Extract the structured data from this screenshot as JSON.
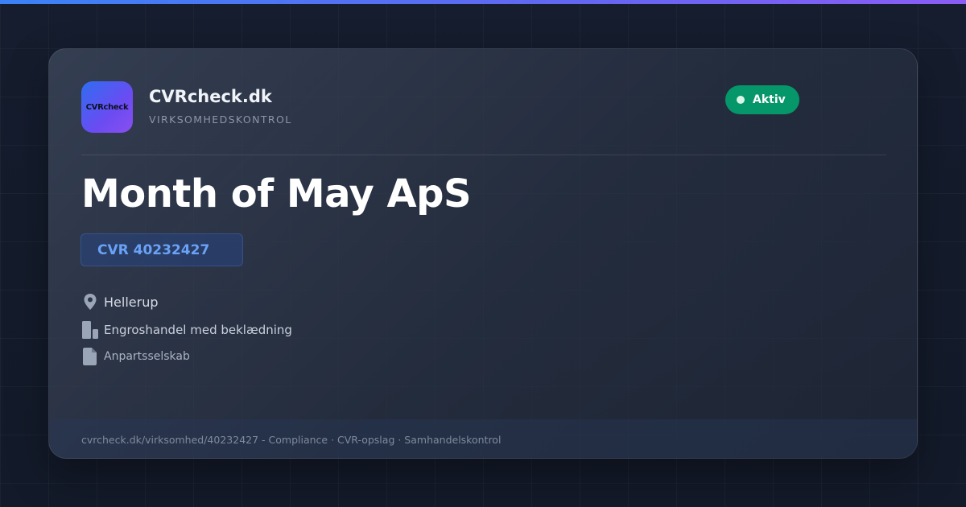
{
  "brand": {
    "name": "CVRcheck.dk",
    "tagline": "VIRKSOMHEDSKONTROL",
    "logo_text": "CVRcheck"
  },
  "status": {
    "label": "Aktiv",
    "color": "#059669"
  },
  "company": {
    "name": "Month of May ApS",
    "cvr": "CVR 40232427",
    "city": "Hellerup",
    "industry": "Engroshandel med beklædning",
    "type": "Anpartsselskab"
  },
  "icons": {
    "city": "location-pin-icon",
    "industry": "building-icon",
    "type": "document-icon"
  },
  "footer": {
    "text": "cvrcheck.dk/virksomhed/40232427 - Compliance · CVR-opslag · Samhandelskontrol"
  },
  "colors": {
    "accent_blue": "#3b82f6",
    "accent_purple": "#8b5cf6",
    "cvr_text": "#6aa2f7"
  }
}
